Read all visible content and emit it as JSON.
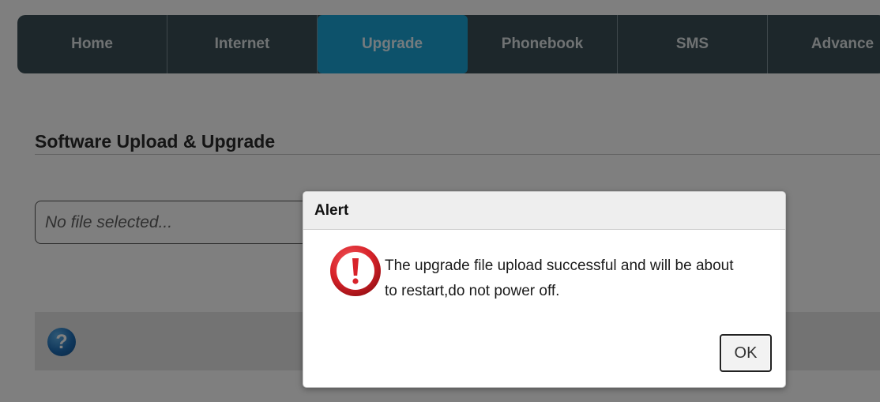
{
  "nav": {
    "items": [
      {
        "label": "Home"
      },
      {
        "label": "Internet"
      },
      {
        "label": "Upgrade"
      },
      {
        "label": "Phonebook"
      },
      {
        "label": "SMS"
      },
      {
        "label": "Advance"
      }
    ],
    "active_index": 2
  },
  "page": {
    "section_title": "Software Upload & Upgrade",
    "file_input_placeholder": "No file selected...",
    "help_icon_glyph": "?"
  },
  "dialog": {
    "title": "Alert",
    "icon": "exclamation-alert-icon",
    "message": "The upgrade file upload successful and will be about to restart,do not power off.",
    "ok_label": "OK"
  },
  "colors": {
    "nav_background": "#3b4f56",
    "nav_active": "#1ba4d6",
    "alert_red": "#d8232a",
    "help_blue": "#1f6fb8"
  }
}
